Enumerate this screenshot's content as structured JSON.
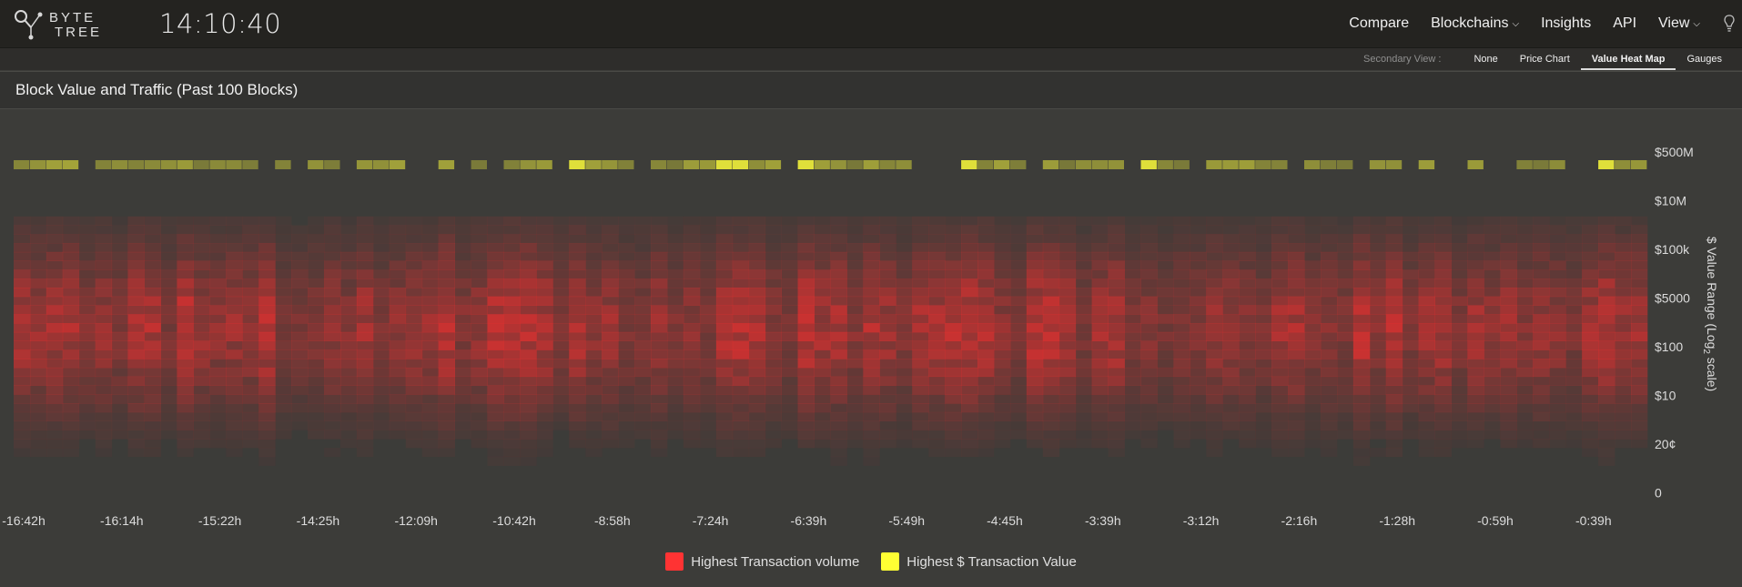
{
  "header": {
    "brand_top": "BYTE",
    "brand_bottom": "TREE",
    "clock": "14:10:40",
    "nav": [
      {
        "label": "Compare",
        "chevron": false
      },
      {
        "label": "Blockchains",
        "chevron": true
      },
      {
        "label": "Insights",
        "chevron": false
      },
      {
        "label": "API",
        "chevron": false
      },
      {
        "label": "View",
        "chevron": true
      }
    ]
  },
  "secondary_view": {
    "label": "Secondary View :",
    "options": [
      "None",
      "Price Chart",
      "Value Heat Map",
      "Gauges"
    ],
    "active": "Value Heat Map"
  },
  "panel": {
    "title": "Block Value and Traffic (Past 100 Blocks)"
  },
  "colors": {
    "volume": "#ff3333",
    "value": "#ffff33",
    "background": "#3c3c39"
  },
  "chart_data": {
    "type": "heatmap",
    "title": "Block Value and Traffic (Past 100 Blocks)",
    "ylabel": "$ Value Range (Log2 scale)",
    "ylabel_main": "$ Value Range (Log",
    "ylabel_sub": "2",
    "ylabel_end": " scale)",
    "blocks": 100,
    "y_tick_labels": [
      "$500M",
      "$10M",
      "$100k",
      "$5000",
      "$100",
      "$10",
      "20¢",
      "0"
    ],
    "x_tick_labels": [
      "-16:42h",
      "-16:14h",
      "-15:22h",
      "-14:25h",
      "-12:09h",
      "-10:42h",
      "-8:58h",
      "-7:24h",
      "-6:39h",
      "-5:49h",
      "-4:45h",
      "-3:39h",
      "-3:12h",
      "-2:16h",
      "-1:28h",
      "-0:59h",
      "-0:39h"
    ],
    "legend": [
      "Highest Transaction volume",
      "Highest $ Transaction Value"
    ],
    "legend_position": "bottom-center",
    "grid": false
  }
}
